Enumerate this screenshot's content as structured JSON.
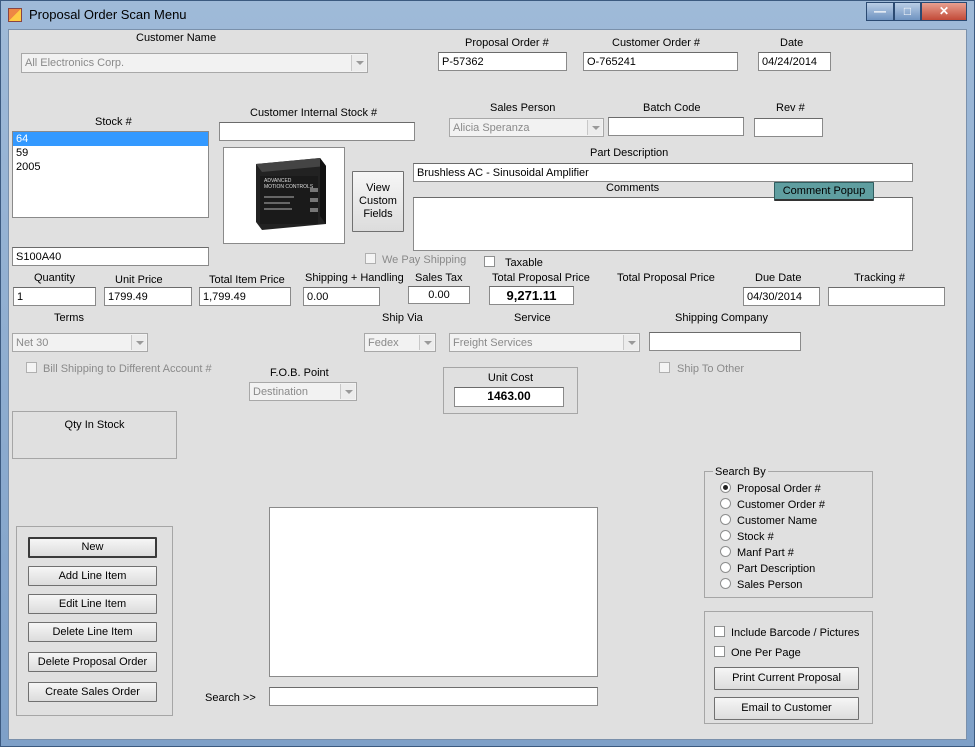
{
  "window": {
    "title": "Proposal Order Scan Menu"
  },
  "labels": {
    "customer_name": "Customer Name",
    "proposal_order": "Proposal Order #",
    "customer_order": "Customer Order #",
    "date": "Date",
    "stock": "Stock #",
    "customer_internal_stock": "Customer Internal Stock #",
    "sales_person": "Sales Person",
    "batch_code": "Batch Code",
    "rev": "Rev #",
    "part_description": "Part Description",
    "comments": "Comments",
    "quantity": "Quantity",
    "unit_price": "Unit Price",
    "total_item_price": "Total Item Price",
    "shipping_handling": "Shipping + Handling",
    "sales_tax": "Sales Tax",
    "total_proposal_price": "Total Proposal Price",
    "total_proposal_price_2": "Total Proposal Price",
    "due_date": "Due Date",
    "tracking": "Tracking #",
    "terms": "Terms",
    "ship_via": "Ship Via",
    "service": "Service",
    "shipping_company": "Shipping Company",
    "fob_point": "F.O.B. Point",
    "unit_cost": "Unit Cost",
    "qty_in_stock": "Qty In Stock",
    "search": "Search >>"
  },
  "fields": {
    "customer_name": "All Electronics Corp.",
    "proposal_order": "P-57362",
    "customer_order": "O-765241",
    "date": "04/24/2014",
    "customer_internal_stock": "",
    "sales_person": "Alicia Speranza",
    "batch_code": "",
    "rev": "",
    "part_description": "Brushless AC - Sinusoidal Amplifier",
    "comments": "",
    "stock_entry": "S100A40",
    "quantity": "1",
    "unit_price": "1799.49",
    "total_item_price": "1,799.49",
    "shipping_handling": "0.00",
    "sales_tax": "0.00",
    "total_proposal_price": "9,271.11",
    "due_date": "04/30/2014",
    "tracking": "",
    "terms": "Net 30",
    "ship_via": "Fedex",
    "service": "Freight Services",
    "shipping_company": "",
    "fob_point": "Destination",
    "unit_cost": "1463.00",
    "search": ""
  },
  "stock_list": [
    "64",
    "59",
    "2005"
  ],
  "product_image": {
    "brand": "ADVANCED",
    "sub": "MOTION CONTROLS"
  },
  "buttons": {
    "view_custom_fields": [
      "View",
      "Custom",
      "Fields"
    ],
    "comment_popup": "Comment Popup",
    "new": "New",
    "add_line_item": "Add Line Item",
    "edit_line_item": "Edit Line Item",
    "delete_line_item": "Delete Line Item",
    "delete_proposal_order": "Delete Proposal Order",
    "create_sales_order": "Create Sales Order",
    "print_current_proposal": "Print Current Proposal",
    "email_to_customer": "Email to Customer"
  },
  "checkboxes": {
    "we_pay_shipping": "We Pay Shipping",
    "taxable": "Taxable",
    "bill_shipping": "Bill Shipping to Different Account #",
    "ship_to_other": "Ship To Other",
    "include_barcode": "Include Barcode / Pictures",
    "one_per_page": "One Per Page"
  },
  "search_by": {
    "title": "Search By",
    "options": [
      "Proposal Order #",
      "Customer Order #",
      "Customer Name",
      "Stock #",
      "Manf Part #",
      "Part Description",
      "Sales Person"
    ],
    "selected": 0
  },
  "colors": {
    "selection": "#3399ff",
    "comment_popup_bg": "#5f9ea0"
  }
}
